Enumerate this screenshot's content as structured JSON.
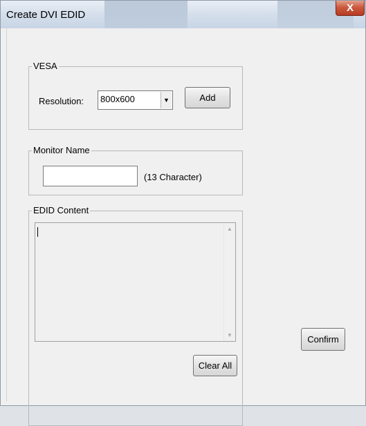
{
  "window": {
    "title": "Create DVI EDID",
    "close_label": "X"
  },
  "vesa": {
    "group_label": "VESA",
    "resolution_label": "Resolution:",
    "resolution_value": "800x600",
    "add_label": "Add"
  },
  "monitor": {
    "group_label": "Monitor Name",
    "name_value": "",
    "hint": "(13 Character)"
  },
  "edid": {
    "group_label": "EDID Content",
    "content": "",
    "clear_label": "Clear All"
  },
  "confirm_label": "Confirm",
  "icons": {
    "dropdown": "chevron-down-icon",
    "scroll_up": "arrow-up-icon",
    "scroll_down": "arrow-down-icon"
  }
}
